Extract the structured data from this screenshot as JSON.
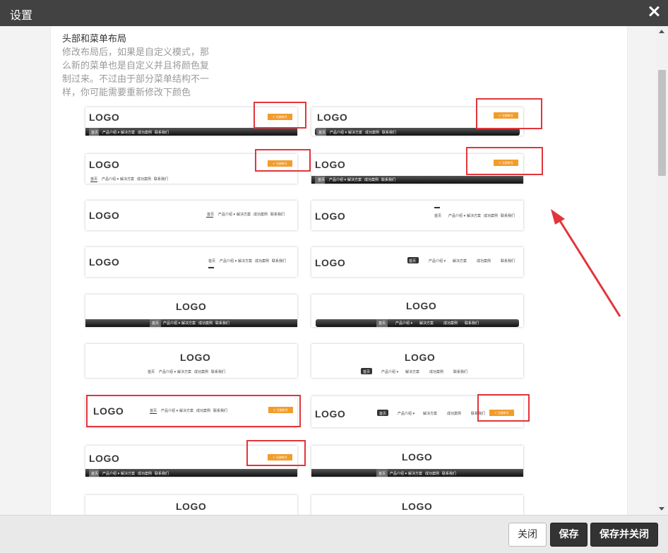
{
  "dialog": {
    "title": "设置"
  },
  "section": {
    "heading": "头部和菜单布局",
    "description": "修改布局后，如果是自定义模式，那么新的菜单也是自定义并且将颜色复制过来。不过由于部分菜单结构不一样，你可能需要重新修改下颜色"
  },
  "template": {
    "logo": "LOGO",
    "button": "✔ 注册帐号",
    "menu": [
      "首页",
      "产品介绍 ▾",
      "解决方案",
      "成功案例",
      "联系我们"
    ]
  },
  "footer": {
    "close_label": "关闭",
    "save_label": "保存",
    "save_close_label": "保存并关闭"
  },
  "colors": {
    "highlight": "#e2353b",
    "accent": "#f39c2a",
    "titlebar": "#424242"
  }
}
